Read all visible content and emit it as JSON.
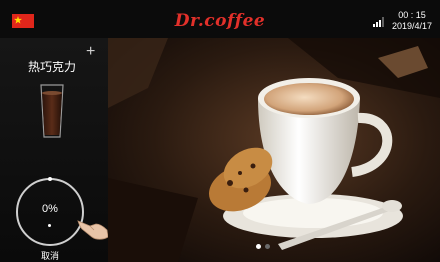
{
  "header": {
    "flag_icon": "china-flag-icon",
    "brand": "Dr.coffee",
    "signal_icon": "signal-bars-icon",
    "time": "00 : 15",
    "date": "2019/4/17"
  },
  "sidebar": {
    "add_icon": "plus-icon",
    "drink_name": "热巧克力",
    "drink_image_icon": "hot-chocolate-glass-icon",
    "progress": "0%",
    "progress_value": 0,
    "hand_icon": "tap-hand-icon",
    "cancel_label": "取消"
  },
  "hero": {
    "image_icon": "coffee-cup-cookies-photo",
    "pager_count": 2,
    "pager_active": 0
  },
  "colors": {
    "brand": "#e2302a",
    "flag": "#e0261b"
  }
}
